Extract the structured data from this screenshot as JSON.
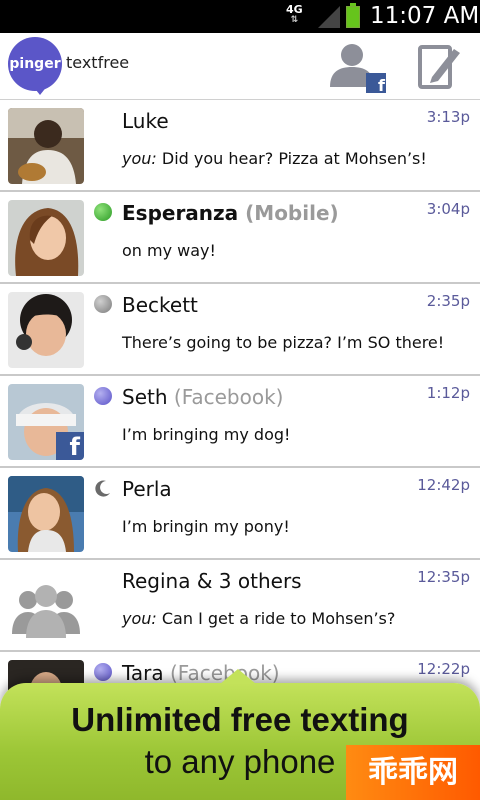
{
  "status_bar": {
    "network": "4G",
    "time": "11:07 AM"
  },
  "app_header": {
    "logo_badge": "pinger",
    "logo_text": "textfree",
    "contacts_icon": "contacts-facebook-icon",
    "compose_icon": "compose-icon"
  },
  "conversations": [
    {
      "name": "Luke",
      "suffix": "",
      "time": "3:13p",
      "you": "you:",
      "message": " Did you hear? Pizza at Mohsen’s!",
      "presence": "none",
      "bold": false
    },
    {
      "name": "Esperanza",
      "suffix": " (Mobile)",
      "time": "3:04p",
      "you": "",
      "message": "on my way!",
      "presence": "online-green",
      "bold": true
    },
    {
      "name": "Beckett",
      "suffix": "",
      "time": "2:35p",
      "you": "",
      "message": "There’s going to be pizza? I’m SO there!",
      "presence": "offline-gray",
      "bold": false
    },
    {
      "name": "Seth",
      "suffix": " (Facebook)",
      "time": "1:12p",
      "you": "",
      "message": "I’m bringing my dog!",
      "presence": "online-purple",
      "bold": false
    },
    {
      "name": "Perla",
      "suffix": "",
      "time": "12:42p",
      "you": "",
      "message": "I’m bringin my pony!",
      "presence": "idle-moon",
      "bold": false
    },
    {
      "name": "Regina & 3 others",
      "suffix": "",
      "time": "12:35p",
      "you": "you:",
      "message": " Can I get a ride to Mohsen’s?",
      "presence": "none",
      "bold": false
    },
    {
      "name": "Tara",
      "suffix": " (Facebook)",
      "time": "12:22p",
      "you": "",
      "message": "",
      "presence": "online-purple",
      "bold": false
    }
  ],
  "promo": {
    "line1": "Unlimited free texting",
    "line2": "to any phone"
  },
  "watermark": "乖乖网",
  "colors": {
    "brand_purple": "#5b56c8",
    "online_green": "#3fb43a",
    "promo_green": "#9cc636",
    "time_text": "#5a5a9a"
  }
}
